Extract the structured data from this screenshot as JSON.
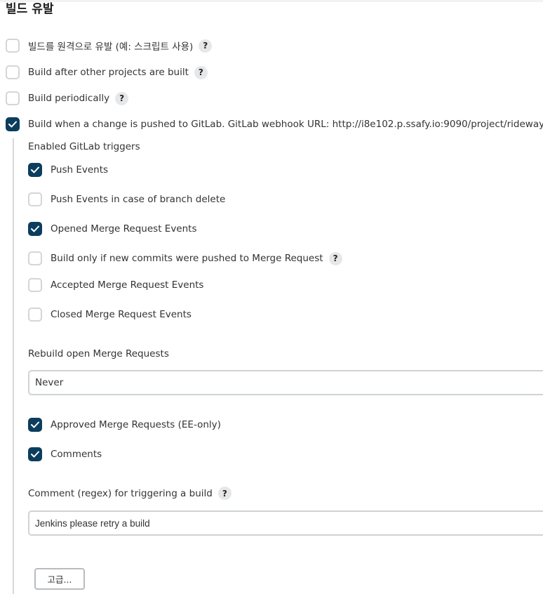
{
  "section": {
    "title": "빌드 유발"
  },
  "triggers": [
    {
      "label": "빌드를 원격으로 유발 (예: 스크립트 사용)",
      "checked": false,
      "help": "?"
    },
    {
      "label": "Build after other projects are built",
      "checked": false,
      "help": "?"
    },
    {
      "label": "Build periodically",
      "checked": false,
      "help": "?"
    },
    {
      "label": "Build when a change is pushed to GitLab. GitLab webhook URL: http://i8e102.p.ssafy.io:9090/project/rideway",
      "checked": true,
      "help": "?"
    }
  ],
  "gitlab": {
    "enabled_triggers_label": "Enabled GitLab triggers",
    "events": [
      {
        "label": "Push Events",
        "checked": true
      },
      {
        "label": "Push Events in case of branch delete",
        "checked": false
      },
      {
        "label": "Opened Merge Request Events",
        "checked": true
      },
      {
        "label": "Build only if new commits were pushed to Merge Request",
        "checked": false,
        "help": "?"
      },
      {
        "label": "Accepted Merge Request Events",
        "checked": false
      },
      {
        "label": "Closed Merge Request Events",
        "checked": false
      }
    ],
    "rebuild": {
      "label": "Rebuild open Merge Requests",
      "value": "Never"
    },
    "more_events": [
      {
        "label": "Approved Merge Requests (EE-only)",
        "checked": true
      },
      {
        "label": "Comments",
        "checked": true
      }
    ],
    "comment_regex": {
      "label": "Comment (regex) for triggering a build",
      "help": "?",
      "value": "Jenkins please retry a build"
    },
    "advanced_button": "고급..."
  },
  "colors": {
    "checkbox_checked": "#0b3d5e",
    "checkbox_border": "#d3d5d8",
    "help_bg": "#e6e7e8"
  }
}
